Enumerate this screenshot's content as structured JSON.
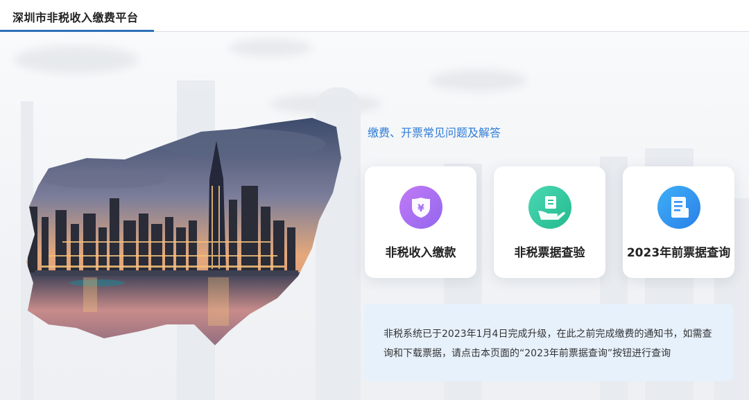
{
  "header": {
    "title": "深圳市非税收入缴费平台"
  },
  "main": {
    "faq_link": "缴费、开票常见问题及解答",
    "cards": [
      {
        "label": "非税收入缴款",
        "icon": "yuan-shield-icon",
        "color": "#a970f0"
      },
      {
        "label": "非税票据查验",
        "icon": "hand-receipt-icon",
        "color": "#2fc9a0"
      },
      {
        "label": "2023年前票据查询",
        "icon": "document-search-icon",
        "color": "#2f8ef0"
      }
    ],
    "notice": "非税系统已于2023年1月4日完成升级，在此之前完成缴费的通知书，如需查询和下载票据，请点击本页面的“2023年前票据查询”按钮进行查询"
  }
}
